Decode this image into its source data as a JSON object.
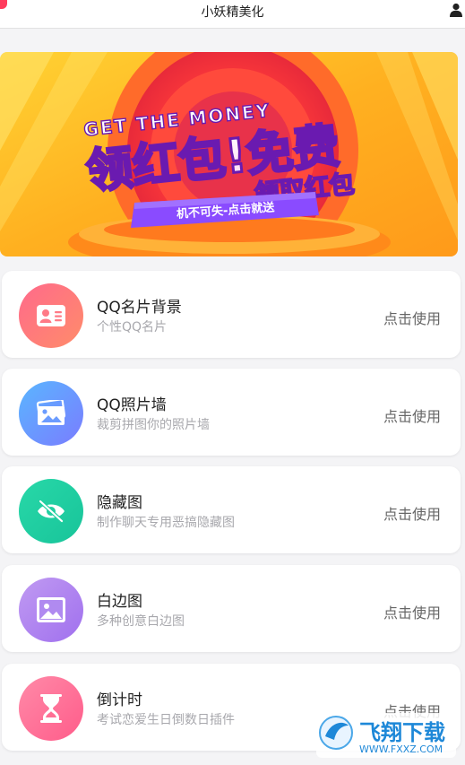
{
  "header": {
    "title": "小妖精美化"
  },
  "banner": {
    "line1": "GET THE MONEY",
    "line2": "领红包!免费",
    "line3": "领取红包",
    "ribbon": "机不可失-点击就送"
  },
  "items": [
    {
      "title": "QQ名片背景",
      "subtitle": "个性QQ名片",
      "action": "点击使用",
      "icon": "id-card-icon",
      "color_from": "#ff6a8b",
      "color_to": "#ff8c6a"
    },
    {
      "title": "QQ照片墙",
      "subtitle": "裁剪拼图你的照片墙",
      "action": "点击使用",
      "icon": "photo-stack-icon",
      "color_from": "#5ab6ff",
      "color_to": "#7a7cff"
    },
    {
      "title": "隐藏图",
      "subtitle": "制作聊天专用恶搞隐藏图",
      "action": "点击使用",
      "icon": "eye-off-icon",
      "color_from": "#28d8a8",
      "color_to": "#18c49a"
    },
    {
      "title": "白边图",
      "subtitle": "多种创意白边图",
      "action": "点击使用",
      "icon": "image-icon",
      "color_from": "#b68cf0",
      "color_to": "#a070ee"
    },
    {
      "title": "倒计时",
      "subtitle": "考试恋爱生日倒数日插件",
      "action": "点击使用",
      "icon": "hourglass-icon",
      "color_from": "#ff7aa0",
      "color_to": "#ff5c8a"
    }
  ],
  "watermark": {
    "main": "飞翔下载",
    "sub": "WWW.FXXZ.COM"
  }
}
